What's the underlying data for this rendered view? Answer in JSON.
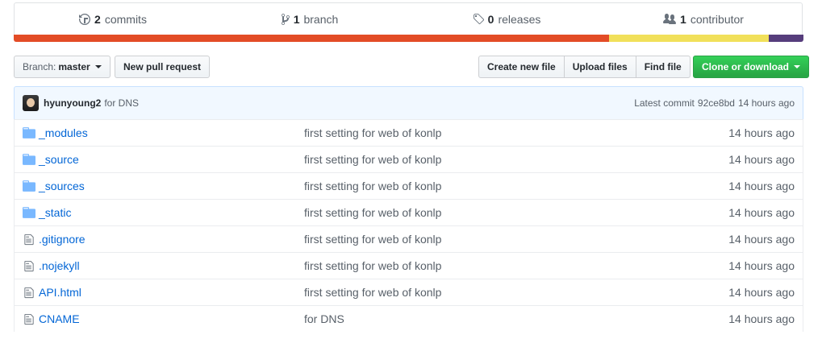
{
  "summary": {
    "commits": {
      "count": "2",
      "label": "commits",
      "icon": "history-icon"
    },
    "branches": {
      "count": "1",
      "label": "branch",
      "icon": "branch-icon"
    },
    "releases": {
      "count": "0",
      "label": "releases",
      "icon": "tag-icon"
    },
    "contributors": {
      "count": "1",
      "label": "contributor",
      "icon": "people-icon"
    }
  },
  "language_bar": [
    {
      "color": "#e34c26",
      "share": 0.754
    },
    {
      "color": "#f1e05a",
      "share": 0.202
    },
    {
      "color": "#563d7c",
      "share": 0.044
    }
  ],
  "toolbar": {
    "branch_prefix": "Branch:",
    "branch_name": "master",
    "new_pull_request": "New pull request",
    "create_new_file": "Create new file",
    "upload_files": "Upload files",
    "find_file": "Find file",
    "clone_or_download": "Clone or download"
  },
  "latest_commit": {
    "author": "hyunyoung2",
    "message": "for DNS",
    "label": "Latest commit",
    "sha": "92ce8bd",
    "age": "14 hours ago"
  },
  "files": [
    {
      "type": "dir",
      "name": "_modules",
      "message": "first setting for web of konlp",
      "age": "14 hours ago"
    },
    {
      "type": "dir",
      "name": "_source",
      "message": "first setting for web of konlp",
      "age": "14 hours ago"
    },
    {
      "type": "dir",
      "name": "_sources",
      "message": "first setting for web of konlp",
      "age": "14 hours ago"
    },
    {
      "type": "dir",
      "name": "_static",
      "message": "first setting for web of konlp",
      "age": "14 hours ago"
    },
    {
      "type": "file",
      "name": ".gitignore",
      "message": "first setting for web of konlp",
      "age": "14 hours ago"
    },
    {
      "type": "file",
      "name": ".nojekyll",
      "message": "first setting for web of konlp",
      "age": "14 hours ago"
    },
    {
      "type": "file",
      "name": "API.html",
      "message": "first setting for web of konlp",
      "age": "14 hours ago"
    },
    {
      "type": "file",
      "name": "CNAME",
      "message": "for DNS",
      "age": "14 hours ago"
    }
  ]
}
